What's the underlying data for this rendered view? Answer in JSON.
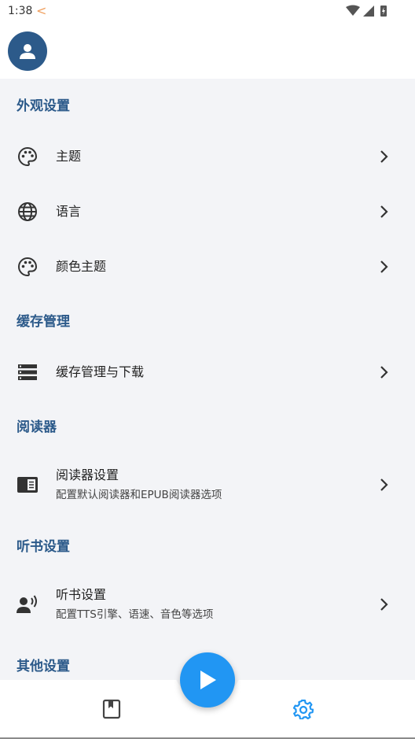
{
  "status_bar": {
    "time": "1:38",
    "back_glyph": "<",
    "icons": [
      "wifi-icon",
      "signal-icon",
      "battery-icon"
    ]
  },
  "header": {
    "avatar_icon": "person-icon",
    "avatar_color": "#2c5a8a"
  },
  "sections": {
    "appearance": {
      "title": "外观设置",
      "items": [
        {
          "label": "主题",
          "icon": "palette-icon"
        },
        {
          "label": "语言",
          "icon": "globe-icon"
        },
        {
          "label": "颜色主题",
          "icon": "palette-icon"
        }
      ]
    },
    "cache": {
      "title": "缓存管理",
      "items": [
        {
          "label": "缓存管理与下载",
          "icon": "storage-icon"
        }
      ]
    },
    "reader": {
      "title": "阅读器",
      "items": [
        {
          "label": "阅读器设置",
          "subtitle": "配置默认阅读器和EPUB阅读器选项",
          "icon": "reader-icon"
        }
      ]
    },
    "audiobook": {
      "title": "听书设置",
      "items": [
        {
          "label": "听书设置",
          "subtitle": "配置TTS引擎、语速、音色等选项",
          "icon": "voice-icon"
        }
      ]
    },
    "other": {
      "title": "其他设置"
    }
  },
  "bottom_nav": {
    "items": [
      "library-icon",
      "play-icon",
      "settings-icon"
    ],
    "active": "settings-icon",
    "accent_color": "#2196f3"
  }
}
